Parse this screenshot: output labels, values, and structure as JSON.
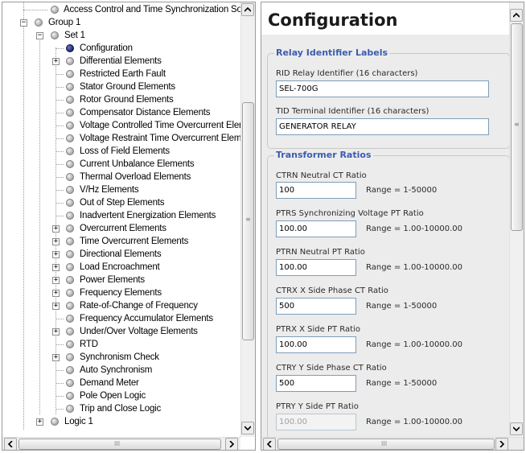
{
  "tree": {
    "items": [
      {
        "label": "Access Control and Time Synchronization Sou",
        "expander": ""
      },
      {
        "label": "Group 1",
        "expander": "−"
      },
      {
        "label": "Set 1",
        "expander": "−"
      },
      {
        "label": "Configuration",
        "expander": "",
        "selected": true
      },
      {
        "label": "Differential Elements",
        "expander": "+"
      },
      {
        "label": "Restricted Earth Fault",
        "expander": ""
      },
      {
        "label": "Stator Ground Elements",
        "expander": ""
      },
      {
        "label": "Rotor Ground Elements",
        "expander": ""
      },
      {
        "label": "Compensator Distance Elements",
        "expander": ""
      },
      {
        "label": "Voltage Controlled Time Overcurrent Elem",
        "expander": ""
      },
      {
        "label": "Voltage Restraint Time Overcurrent Eleme",
        "expander": ""
      },
      {
        "label": "Loss of Field Elements",
        "expander": ""
      },
      {
        "label": "Current Unbalance Elements",
        "expander": ""
      },
      {
        "label": "Thermal Overload  Elements",
        "expander": ""
      },
      {
        "label": "V/Hz Elements",
        "expander": ""
      },
      {
        "label": "Out of Step Elements",
        "expander": ""
      },
      {
        "label": "Inadvertent Energization Elements",
        "expander": ""
      },
      {
        "label": "Overcurrent Elements",
        "expander": "+"
      },
      {
        "label": "Time Overcurrent Elements",
        "expander": "+"
      },
      {
        "label": "Directional Elements",
        "expander": "+"
      },
      {
        "label": "Load Encroachment",
        "expander": "+"
      },
      {
        "label": "Power Elements",
        "expander": "+"
      },
      {
        "label": "Frequency Elements",
        "expander": "+"
      },
      {
        "label": "Rate-of-Change of Frequency",
        "expander": "+"
      },
      {
        "label": "Frequency Accumulator Elements",
        "expander": ""
      },
      {
        "label": "Under/Over Voltage Elements",
        "expander": "+"
      },
      {
        "label": "RTD",
        "expander": ""
      },
      {
        "label": "Synchronism Check",
        "expander": "+"
      },
      {
        "label": "Auto Synchronism",
        "expander": ""
      },
      {
        "label": "Demand Meter",
        "expander": ""
      },
      {
        "label": "Pole Open Logic",
        "expander": ""
      },
      {
        "label": "Trip and Close Logic",
        "expander": ""
      },
      {
        "label": "Logic 1",
        "expander": "+"
      }
    ]
  },
  "config": {
    "title": "Configuration",
    "sections": {
      "relay_labels": {
        "title": "Relay Identifier Labels",
        "rid": {
          "label": "RID  Relay Identifier (16 characters)",
          "value": "SEL-700G"
        },
        "tid": {
          "label": "TID  Terminal Identifier (16 characters)",
          "value": "GENERATOR RELAY"
        }
      },
      "transformer_ratios": {
        "title": "Transformer Ratios",
        "fields": [
          {
            "label": "CTRN  Neutral CT Ratio",
            "value": "100",
            "range": "Range = 1-50000",
            "disabled": false
          },
          {
            "label": "PTRS  Synchronizing Voltage PT Ratio",
            "value": "100.00",
            "range": "Range = 1.00-10000.00",
            "disabled": false
          },
          {
            "label": "PTRN  Neutral PT Ratio",
            "value": "100.00",
            "range": "Range = 1.00-10000.00",
            "disabled": false
          },
          {
            "label": "CTRX  X Side Phase CT Ratio",
            "value": "500",
            "range": "Range = 1-50000",
            "disabled": false
          },
          {
            "label": "PTRX  X Side PT Ratio",
            "value": "100.00",
            "range": "Range = 1.00-10000.00",
            "disabled": false
          },
          {
            "label": "CTRY  Y Side Phase CT Ratio",
            "value": "500",
            "range": "Range = 1-50000",
            "disabled": false
          },
          {
            "label": "PTRY  Y Side PT Ratio",
            "value": "100.00",
            "range": "Range = 1.00-10000.00",
            "disabled": true
          }
        ]
      }
    }
  },
  "scrollbars": {
    "grip_vertical": "≡",
    "grip_horizontal": "III"
  }
}
